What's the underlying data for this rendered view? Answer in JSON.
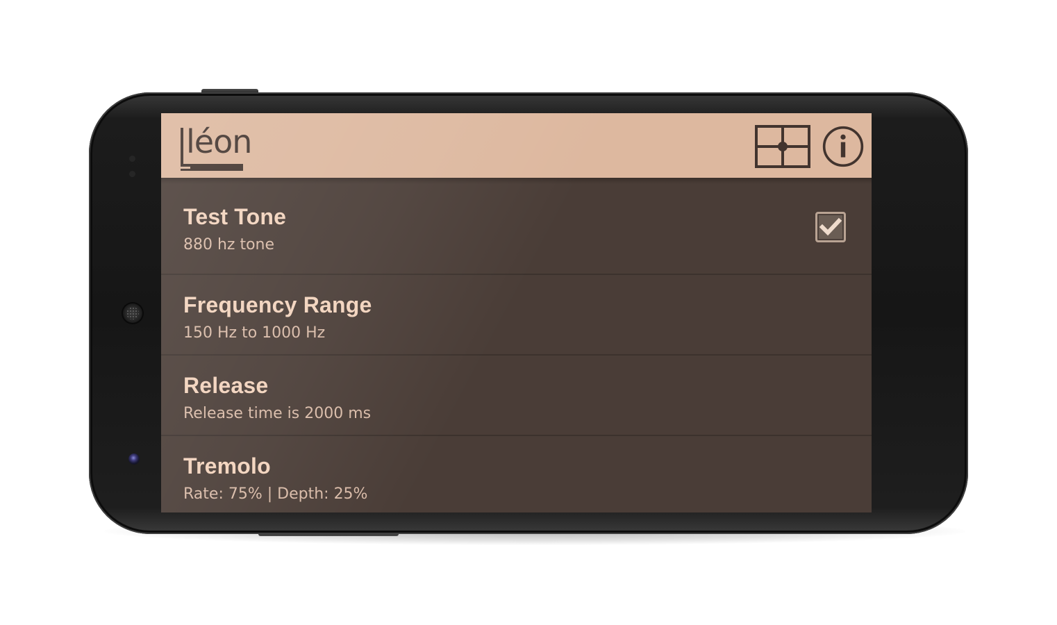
{
  "app": {
    "logo_text": "léon"
  },
  "actions": {
    "grid_icon": "grid-crosshair-icon",
    "info_icon": "info-icon"
  },
  "settings": [
    {
      "title": "Test Tone",
      "summary": "880 hz tone",
      "checked": true
    },
    {
      "title": "Frequency Range",
      "summary": "150 Hz to 1000 Hz"
    },
    {
      "title": "Release",
      "summary": "Release time is 2000 ms"
    },
    {
      "title": "Tremolo",
      "summary": "Rate: 75% | Depth: 25%"
    }
  ],
  "colors": {
    "action_bar": "#ddb89f",
    "background": "#4a3d37",
    "text_title": "#f2d3bd",
    "text_summary": "#d9bba8",
    "icon": "#42342e"
  }
}
